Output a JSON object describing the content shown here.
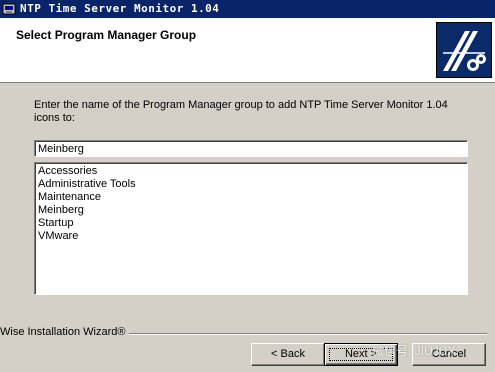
{
  "window": {
    "title": "NTP Time Server Monitor 1.04",
    "icon": "installer-icon"
  },
  "header": {
    "title": "Select Program Manager Group",
    "logo": "wizard-logo-icon"
  },
  "main": {
    "prompt": "Enter the name of the Program Manager group to add NTP Time Server Monitor 1.04 icons to:",
    "group_input": {
      "value": "Meinberg"
    },
    "groups": [
      "Accessories",
      "Administrative Tools",
      "Maintenance",
      "Meinberg",
      "Startup",
      "VMware"
    ]
  },
  "footer": {
    "group_label": "Wise Installation Wizard®",
    "back_label": "< Back",
    "next_label": "Next >",
    "cancel_label": "Cancel"
  },
  "watermark": "微信号: JIUJUX"
}
